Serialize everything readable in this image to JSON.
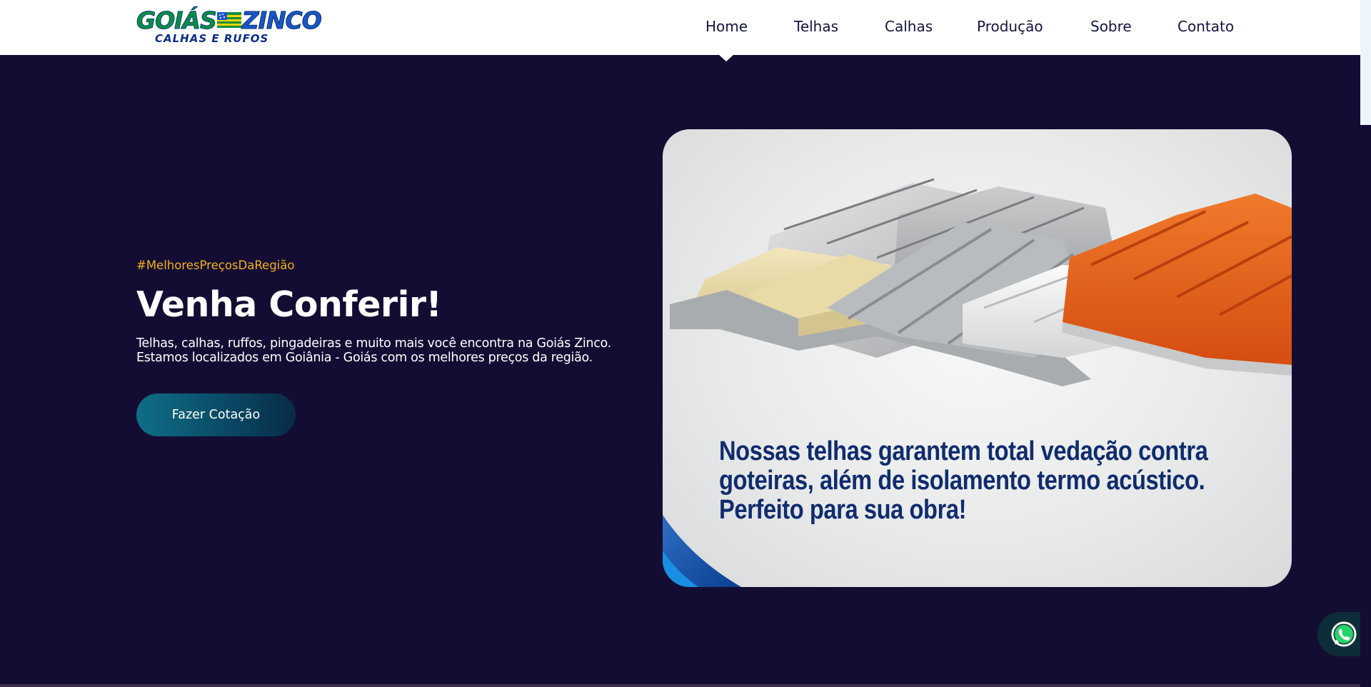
{
  "header": {
    "logo": {
      "word1": "GOIÁS",
      "word2": "ZINCO",
      "tagline": "CALHAS E RUFOS"
    },
    "nav": [
      {
        "label": "Home",
        "active": true
      },
      {
        "label": "Telhas"
      },
      {
        "label": "Calhas"
      },
      {
        "label": "Produção"
      },
      {
        "label": "Sobre"
      },
      {
        "label": "Contato"
      }
    ]
  },
  "hero": {
    "hashtag": "#MelhoresPreçosDaRegião",
    "title": "Venha Conferir!",
    "description_line1": "Telhas, calhas, ruffos, pingadeiras e muito mais você encontra na Goiás Zinco.",
    "description_line2": "Estamos localizados em Goiânia - Goiás com os melhores preços da região.",
    "cta_label": "Fazer Cotação",
    "image_caption": [
      "Nossas telhas garantem total vedação contra",
      "goteiras, além de isolamento termo acústico.",
      "Perfeito para sua obra!"
    ]
  },
  "colors": {
    "background": "#140d33",
    "accent": "#f2b21c",
    "nav_text": "#141440",
    "caption": "#0f2c6e",
    "whatsapp": "#25d366"
  },
  "icons": {
    "whatsapp": "whatsapp-icon"
  }
}
